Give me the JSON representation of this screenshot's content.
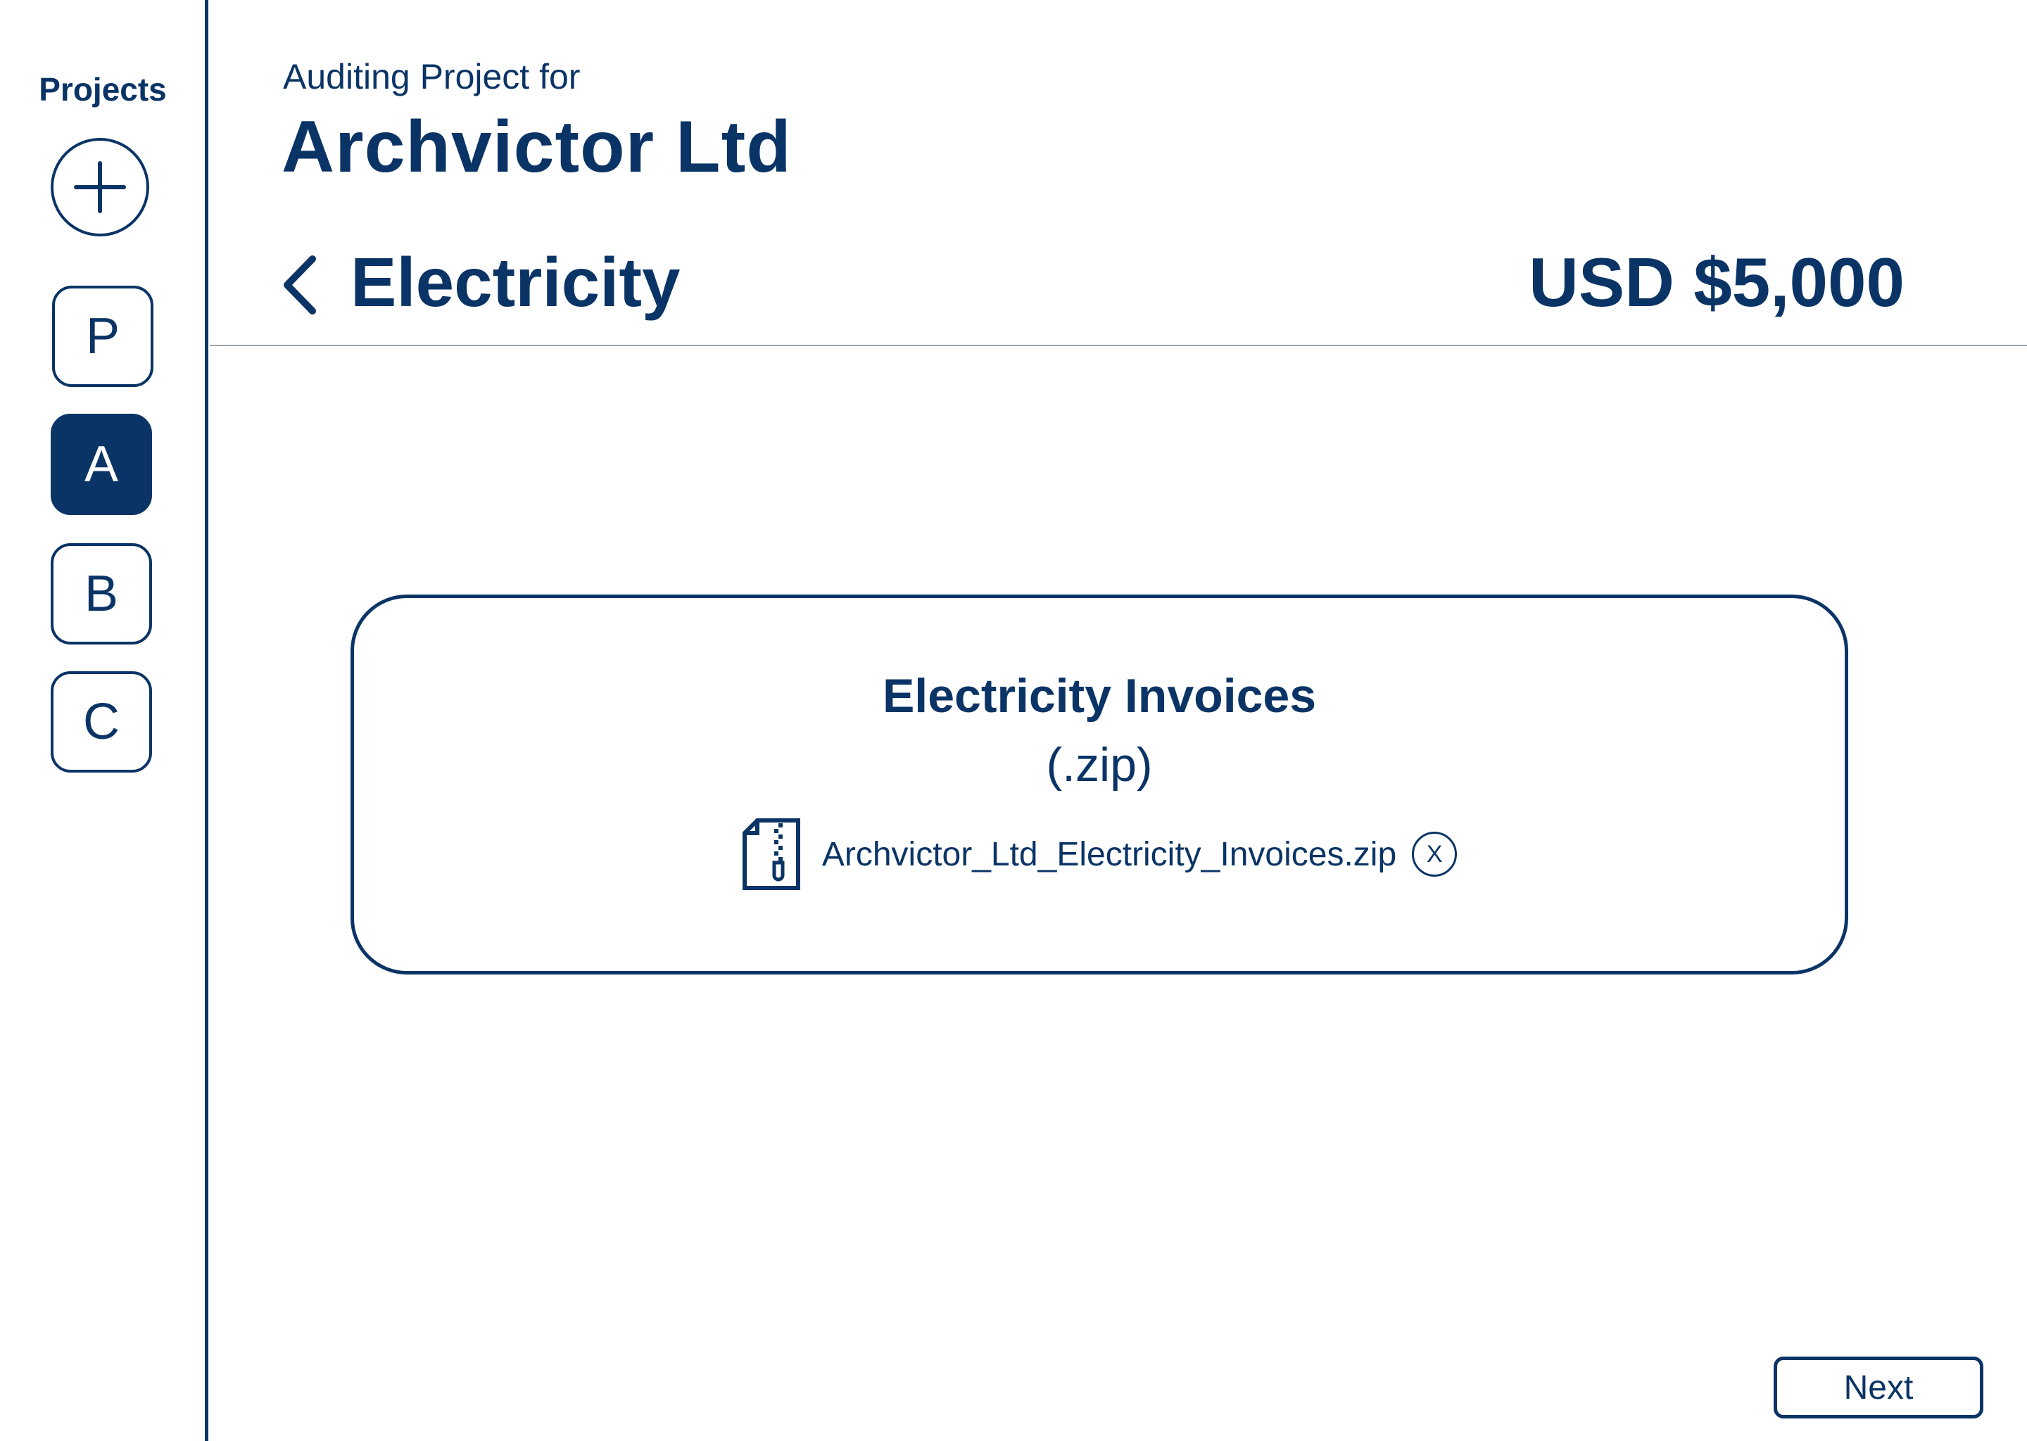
{
  "colors": {
    "primary": "#0b3466",
    "divider": "#9aa3ad",
    "background": "#ffffff"
  },
  "sidebar": {
    "title": "Projects",
    "add_icon": "plus-circle-icon",
    "projects": [
      {
        "label": "P",
        "active": false
      },
      {
        "label": "A",
        "active": true
      },
      {
        "label": "B",
        "active": false
      },
      {
        "label": "C",
        "active": false
      }
    ]
  },
  "header": {
    "subtitle": "Auditing Project for",
    "company": "Archvictor Ltd",
    "back_icon": "chevron-left-icon",
    "section": "Electricity",
    "amount": "USD $5,000"
  },
  "upload": {
    "title": "Electricity Invoices",
    "format": "(.zip)",
    "file_icon": "zip-file-icon",
    "file_name": "Archvictor_Ltd_Electricity_Invoices.zip",
    "remove_label": "X"
  },
  "footer": {
    "next_label": "Next"
  }
}
